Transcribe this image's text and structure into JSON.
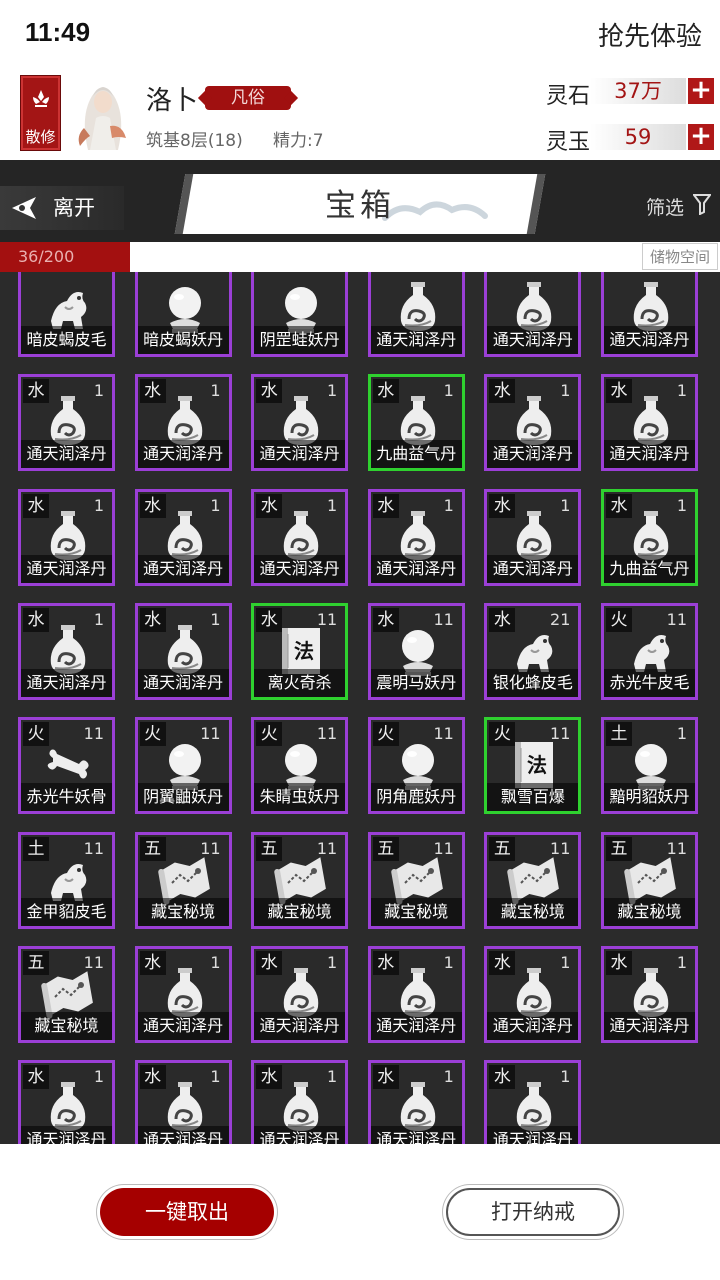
{
  "status": {
    "time": "11:49",
    "early_access": "抢先体验"
  },
  "player": {
    "sect": "散修",
    "name": "洛卜",
    "rank": "凡俗",
    "stage": "筑基8层(18)",
    "energy": "精力:7"
  },
  "currency": [
    {
      "label": "灵石",
      "value": "37万"
    },
    {
      "label": "灵玉",
      "value": "59"
    }
  ],
  "nav": {
    "leave": "离开",
    "title": "宝箱",
    "filter": "筛选"
  },
  "capacity": {
    "text": "36/200",
    "fraction": 0.18,
    "storage_label": "储物空间"
  },
  "items": [
    {
      "el": "",
      "count": "",
      "name": "暗皮蝎皮毛",
      "icon": "beast",
      "frame": "purple"
    },
    {
      "el": "",
      "count": "",
      "name": "暗皮蝎妖丹",
      "icon": "orb",
      "frame": "purple"
    },
    {
      "el": "",
      "count": "",
      "name": "阴罡蛙妖丹",
      "icon": "orb",
      "frame": "purple"
    },
    {
      "el": "",
      "count": "",
      "name": "通天润泽丹",
      "icon": "bottle",
      "frame": "purple"
    },
    {
      "el": "",
      "count": "",
      "name": "通天润泽丹",
      "icon": "bottle",
      "frame": "purple"
    },
    {
      "el": "",
      "count": "",
      "name": "通天润泽丹",
      "icon": "bottle",
      "frame": "purple"
    },
    {
      "el": "水",
      "count": "1",
      "name": "通天润泽丹",
      "icon": "bottle",
      "frame": "purple"
    },
    {
      "el": "水",
      "count": "1",
      "name": "通天润泽丹",
      "icon": "bottle",
      "frame": "purple"
    },
    {
      "el": "水",
      "count": "1",
      "name": "通天润泽丹",
      "icon": "bottle",
      "frame": "purple"
    },
    {
      "el": "水",
      "count": "1",
      "name": "九曲益气丹",
      "icon": "bottle",
      "frame": "green"
    },
    {
      "el": "水",
      "count": "1",
      "name": "通天润泽丹",
      "icon": "bottle",
      "frame": "purple"
    },
    {
      "el": "水",
      "count": "1",
      "name": "通天润泽丹",
      "icon": "bottle",
      "frame": "purple"
    },
    {
      "el": "水",
      "count": "1",
      "name": "通天润泽丹",
      "icon": "bottle",
      "frame": "purple"
    },
    {
      "el": "水",
      "count": "1",
      "name": "通天润泽丹",
      "icon": "bottle",
      "frame": "purple"
    },
    {
      "el": "水",
      "count": "1",
      "name": "通天润泽丹",
      "icon": "bottle",
      "frame": "purple"
    },
    {
      "el": "水",
      "count": "1",
      "name": "通天润泽丹",
      "icon": "bottle",
      "frame": "purple"
    },
    {
      "el": "水",
      "count": "1",
      "name": "通天润泽丹",
      "icon": "bottle",
      "frame": "purple"
    },
    {
      "el": "水",
      "count": "1",
      "name": "九曲益气丹",
      "icon": "bottle",
      "frame": "green"
    },
    {
      "el": "水",
      "count": "1",
      "name": "通天润泽丹",
      "icon": "bottle",
      "frame": "purple"
    },
    {
      "el": "水",
      "count": "1",
      "name": "通天润泽丹",
      "icon": "bottle",
      "frame": "purple"
    },
    {
      "el": "水",
      "count": "11",
      "name": "离火奇杀",
      "icon": "book",
      "frame": "green"
    },
    {
      "el": "水",
      "count": "11",
      "name": "震明马妖丹",
      "icon": "orb",
      "frame": "purple"
    },
    {
      "el": "水",
      "count": "21",
      "name": "银化蜂皮毛",
      "icon": "beast",
      "frame": "purple"
    },
    {
      "el": "火",
      "count": "11",
      "name": "赤光牛皮毛",
      "icon": "beast",
      "frame": "purple"
    },
    {
      "el": "火",
      "count": "11",
      "name": "赤光牛妖骨",
      "icon": "bone",
      "frame": "purple"
    },
    {
      "el": "火",
      "count": "11",
      "name": "阴翼鼬妖丹",
      "icon": "orb",
      "frame": "purple"
    },
    {
      "el": "火",
      "count": "11",
      "name": "朱睛虫妖丹",
      "icon": "orb",
      "frame": "purple"
    },
    {
      "el": "火",
      "count": "11",
      "name": "阴角鹿妖丹",
      "icon": "orb",
      "frame": "purple"
    },
    {
      "el": "火",
      "count": "11",
      "name": "飘雪百爆",
      "icon": "book",
      "frame": "green"
    },
    {
      "el": "土",
      "count": "1",
      "name": "黯明貂妖丹",
      "icon": "orb",
      "frame": "purple"
    },
    {
      "el": "土",
      "count": "11",
      "name": "金甲貂皮毛",
      "icon": "beast",
      "frame": "purple"
    },
    {
      "el": "五",
      "count": "11",
      "name": "藏宝秘境",
      "icon": "map",
      "frame": "purple"
    },
    {
      "el": "五",
      "count": "11",
      "name": "藏宝秘境",
      "icon": "map",
      "frame": "purple"
    },
    {
      "el": "五",
      "count": "11",
      "name": "藏宝秘境",
      "icon": "map",
      "frame": "purple"
    },
    {
      "el": "五",
      "count": "11",
      "name": "藏宝秘境",
      "icon": "map",
      "frame": "purple"
    },
    {
      "el": "五",
      "count": "11",
      "name": "藏宝秘境",
      "icon": "map",
      "frame": "purple"
    },
    {
      "el": "五",
      "count": "11",
      "name": "藏宝秘境",
      "icon": "map",
      "frame": "purple"
    },
    {
      "el": "水",
      "count": "1",
      "name": "通天润泽丹",
      "icon": "bottle",
      "frame": "purple"
    },
    {
      "el": "水",
      "count": "1",
      "name": "通天润泽丹",
      "icon": "bottle",
      "frame": "purple"
    },
    {
      "el": "水",
      "count": "1",
      "name": "通天润泽丹",
      "icon": "bottle",
      "frame": "purple"
    },
    {
      "el": "水",
      "count": "1",
      "name": "通天润泽丹",
      "icon": "bottle",
      "frame": "purple"
    },
    {
      "el": "水",
      "count": "1",
      "name": "通天润泽丹",
      "icon": "bottle",
      "frame": "purple"
    },
    {
      "el": "水",
      "count": "1",
      "name": "通天润泽丹",
      "icon": "bottle",
      "frame": "purple"
    },
    {
      "el": "水",
      "count": "1",
      "name": "通天润泽丹",
      "icon": "bottle",
      "frame": "purple"
    },
    {
      "el": "水",
      "count": "1",
      "name": "通天润泽丹",
      "icon": "bottle",
      "frame": "purple"
    },
    {
      "el": "水",
      "count": "1",
      "name": "通天润泽丹",
      "icon": "bottle",
      "frame": "purple"
    },
    {
      "el": "水",
      "count": "1",
      "name": "通天润泽丹",
      "icon": "bottle",
      "frame": "purple"
    }
  ],
  "book_glyph": "法",
  "actions": {
    "take_all": "一键取出",
    "open_ring": "打开纳戒"
  }
}
